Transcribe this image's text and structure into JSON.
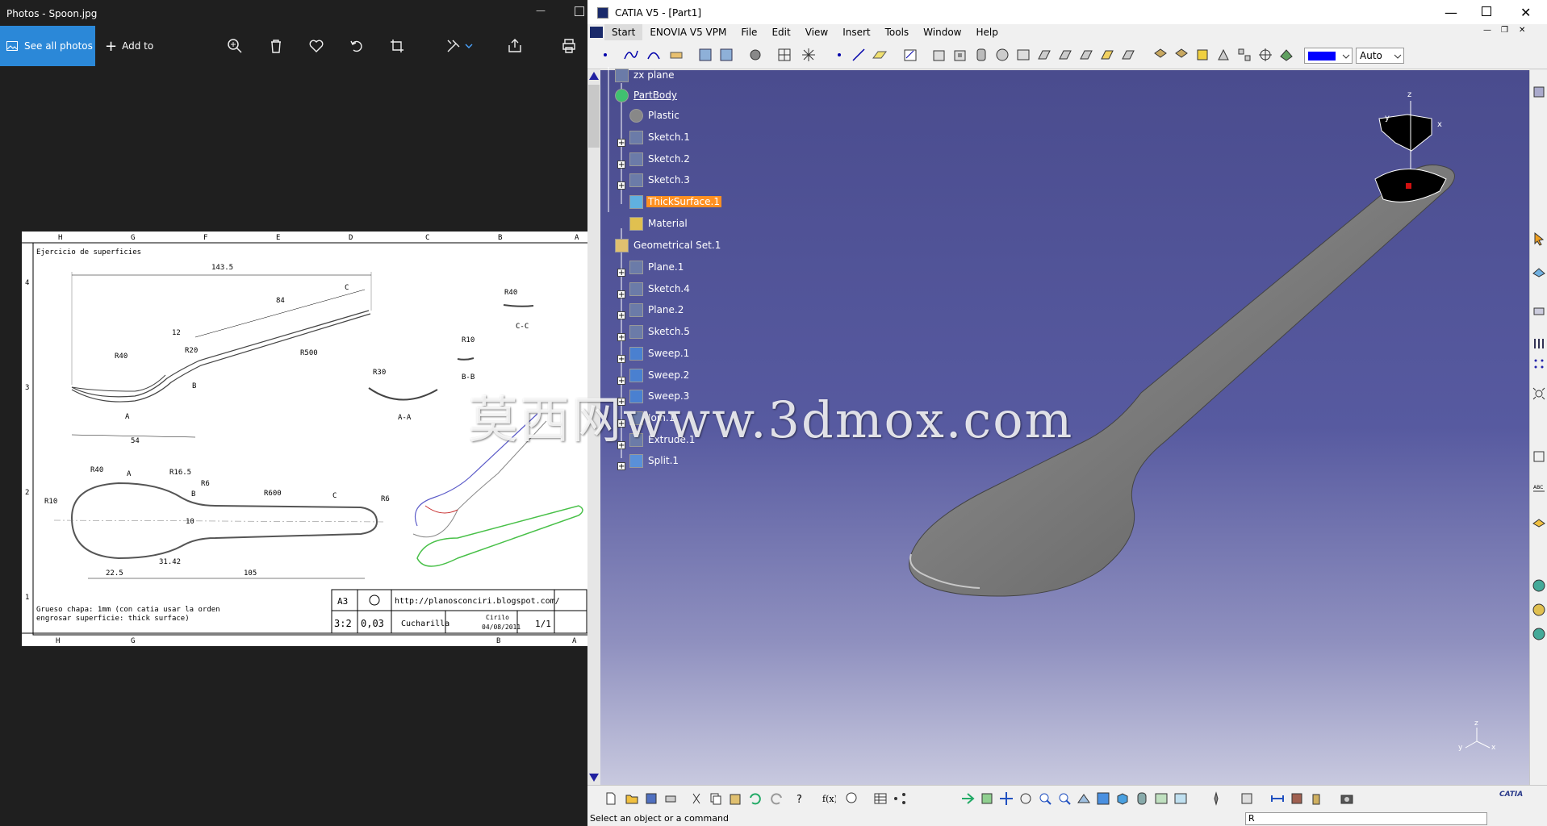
{
  "photos": {
    "title": "Photos - Spoon.jpg",
    "see_all": "See all photos",
    "add_to": "Add to"
  },
  "drawing": {
    "heading": "Ejercicio de superficies",
    "dims": [
      "143.5",
      "84",
      "C",
      "12",
      "R20",
      "R40",
      "R500",
      "B",
      "A",
      "54",
      "R40",
      "C-C",
      "R10",
      "B-B",
      "R30",
      "A-A",
      "R40",
      "A",
      "R16.5",
      "R6",
      "B",
      "R600",
      "C",
      "R6",
      "R10",
      "31.42",
      "22.5",
      "105",
      "10"
    ],
    "note1": "Grueso chapa: 1mm  (con catia usar la orden",
    "note2": "engrosar superficie: thick surface)",
    "tb_format": "A3",
    "tb_url": "http://planosconciri.blogspot.com/",
    "tb_scale": "3:2",
    "tb_value": "0,03",
    "tb_name": "Cucharilla",
    "tb_author": "Cirilo",
    "tb_date": "04/08/2011",
    "tb_sheet": "1/1",
    "col_letters": [
      "H",
      "G",
      "F",
      "E",
      "D",
      "C",
      "B",
      "A"
    ],
    "bottom_letters": [
      "H",
      "G",
      "B",
      "A"
    ],
    "row_numbers": [
      "4",
      "3",
      "2",
      "1"
    ]
  },
  "catia": {
    "title": "CATIA V5 - [Part1]",
    "menu": [
      "Start",
      "ENOVIA V5 VPM",
      "File",
      "Edit",
      "View",
      "Insert",
      "Tools",
      "Window",
      "Help"
    ],
    "render_mode": "Auto",
    "status": "Select an object or a command",
    "command_value": "R",
    "axis_z": "z",
    "axis_x": "x",
    "axis_y": "y",
    "brand": "CATIA",
    "tree": [
      {
        "label": "zx plane",
        "indent": 0
      },
      {
        "label": "PartBody",
        "indent": 0
      },
      {
        "label": "Plastic",
        "indent": 1
      },
      {
        "label": "Sketch.1",
        "indent": 1
      },
      {
        "label": "Sketch.2",
        "indent": 1
      },
      {
        "label": "Sketch.3",
        "indent": 1
      },
      {
        "label": "ThickSurface.1",
        "indent": 1
      },
      {
        "label": "Material",
        "indent": 1
      },
      {
        "label": "Geometrical Set.1",
        "indent": 0
      },
      {
        "label": "Plane.1",
        "indent": 1
      },
      {
        "label": "Sketch.4",
        "indent": 1
      },
      {
        "label": "Plane.2",
        "indent": 1
      },
      {
        "label": "Sketch.5",
        "indent": 1
      },
      {
        "label": "Sweep.1",
        "indent": 1
      },
      {
        "label": "Sweep.2",
        "indent": 1
      },
      {
        "label": "Sweep.3",
        "indent": 1
      },
      {
        "label": "Join.1",
        "indent": 1
      },
      {
        "label": "Extrude.1",
        "indent": 1
      },
      {
        "label": "Split.1",
        "indent": 1
      }
    ]
  },
  "watermark": "莫西网www.3dmox.com",
  "colors": {
    "accent": "#2b88d8",
    "selection": "#ff9022",
    "viewport": "#575aa0"
  }
}
